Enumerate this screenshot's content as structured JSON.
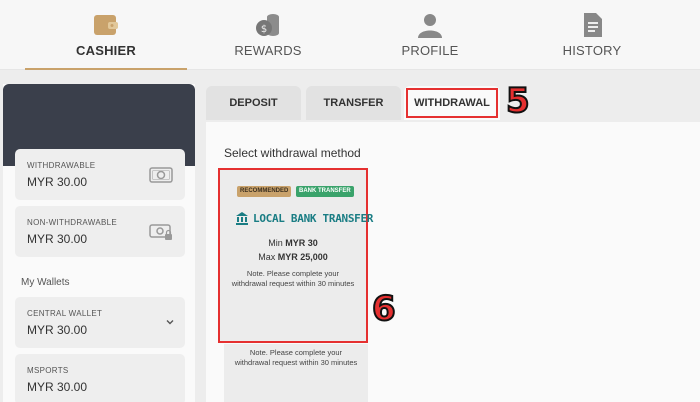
{
  "nav": {
    "items": [
      {
        "label": "CASHIER",
        "icon": "wallet-icon"
      },
      {
        "label": "REWARDS",
        "icon": "coins-icon"
      },
      {
        "label": "PROFILE",
        "icon": "user-icon"
      },
      {
        "label": "HISTORY",
        "icon": "document-icon"
      }
    ],
    "active": "CASHIER"
  },
  "sidebar": {
    "withdrawable": {
      "label": "WITHDRAWABLE",
      "value": "MYR 30.00",
      "icon": "cash-icon"
    },
    "non_withdrawable": {
      "label": "NON-WITHDRAWABLE",
      "value": "MYR 30.00",
      "icon": "locked-cash-icon"
    },
    "my_wallets_label": "My Wallets",
    "central_wallet": {
      "label": "CENTRAL WALLET",
      "value": "MYR 30.00"
    },
    "msports": {
      "label": "MSPORTS",
      "value": "MYR 30.00"
    }
  },
  "tabs": [
    {
      "label": "DEPOSIT"
    },
    {
      "label": "TRANSFER"
    },
    {
      "label": "WITHDRAWAL",
      "active": true
    }
  ],
  "steps": {
    "tab_marker": "5",
    "method_marker": "6"
  },
  "main": {
    "title": "Select withdrawal method",
    "method": {
      "badge_recommended": "RECOMMENDED",
      "badge_type": "BANK TRANSFER",
      "name": "LOCAL BANK TRANSFER",
      "min_prefix": "Min",
      "min_value": "MYR 30",
      "max_prefix": "Max",
      "max_value": "MYR 25,000",
      "note": "Note. Please complete your withdrawal request within 30 minutes"
    },
    "second_note": "Note. Please complete your withdrawal request within 30 minutes"
  },
  "colors": {
    "accent": "#c9a26b",
    "highlight": "#e53030",
    "sidebar_head": "#3a3f4b",
    "bank_teal": "#1a7d84",
    "badge_green": "#3aa36b"
  }
}
